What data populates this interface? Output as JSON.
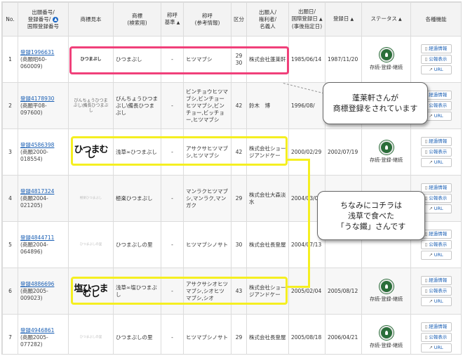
{
  "headers": {
    "no": "No.",
    "app_no": [
      "出願番号/",
      "登録番号/",
      "国際登録番号"
    ],
    "mark": "商標見本",
    "name": [
      "商標",
      "(検索用)"
    ],
    "pron_std": [
      "称呼",
      "基準"
    ],
    "pron_ref": [
      "称呼",
      "(参考情報)"
    ],
    "cls": "区分",
    "applicant": [
      "出願人/",
      "権利者/",
      "名義人"
    ],
    "filed": [
      "出願日/",
      "国際登録日",
      "(事後指定日)"
    ],
    "regdate": "登録日",
    "status": "ステータス",
    "funcs": "各種機能"
  },
  "rows": [
    {
      "no": "1",
      "reg": "登録1996631",
      "app": "(商願昭60-060009)",
      "mark": "ひつまぶし",
      "name": "ひつまぶし",
      "pron_std": "-",
      "pron_ref": "ヒツマブシ",
      "cls": "29\n30",
      "applicant": "株式会社蓬莱軒",
      "filed": "1985/06/14",
      "regdate": "1987/11/20",
      "status": "存続-登録-継続"
    },
    {
      "no": "2",
      "reg": "登録4178930",
      "app": "(商願平08-097600)",
      "mark": "びんちょうひつまぶし\\備長ひつまぶし",
      "name": "びんちょうひつまぶし\\備長ひつまぶし",
      "pron_std": "-",
      "pron_ref": "ビンチョウヒツマブシ,ビンチョーヒツマブシ,ビンチョー,ビッチョー,ヒツマブシ",
      "cls": "42",
      "applicant": "鈴木　博",
      "filed": "1996/08/",
      "regdate": "",
      "status": ""
    },
    {
      "no": "3",
      "reg": "登録4586398",
      "app": "(商願2000-018554)",
      "mark": "ひつまむし",
      "name": "浅草∞ひつまぶし",
      "pron_std": "-",
      "pron_ref": "アサクサヒツマブシ,ヒツマブシ",
      "cls": "42",
      "applicant": "株式会社ショージアンドケー",
      "filed": "2000/02/29",
      "regdate": "2002/07/19",
      "status": "存続-登録-継続"
    },
    {
      "no": "4",
      "reg": "登録4817324",
      "app": "(商願2004-021205)",
      "mark": "極楽ひつまぶし",
      "name": "極楽ひつまぶし",
      "pron_std": "-",
      "pron_ref": "マンラクヒツマブシ,マンラク,マンガク",
      "cls": "29",
      "applicant": "株式会社大森淡水",
      "filed": "2004/03/0",
      "regdate": "",
      "status": ""
    },
    {
      "no": "5",
      "reg": "登録4844711",
      "app": "(商願2004-064896)",
      "mark": "ひつまぶしの里",
      "name": "ひつまぶしの里",
      "pron_std": "-",
      "pron_ref": "ヒツマブシノサト",
      "cls": "30",
      "applicant": "株式会社長登屋",
      "filed": "2004/07/13",
      "regdate": "",
      "status": ""
    },
    {
      "no": "6",
      "reg": "登録4886696",
      "app": "(商願2005-009023)",
      "mark": "塩ひつまむし",
      "name": "浅草∞塩ひつまぶし",
      "pron_std": "-",
      "pron_ref": "アサクサシオヒツマブシ,シオヒツマブシ,シオ",
      "cls": "43",
      "applicant": "株式会社ショージアンドケー",
      "filed": "2005/02/04",
      "regdate": "2005/08/12",
      "status": "存続-登録-継続"
    },
    {
      "no": "7",
      "reg": "登録4946861",
      "app": "(商願2005-077282)",
      "mark": "ひつまぶしの里",
      "name": "ひつまぶしの里",
      "pron_std": "-",
      "pron_ref": "ヒツマブシノサト",
      "cls": "29",
      "applicant": "株式会社長登屋",
      "filed": "2005/08/18",
      "regdate": "2006/04/21",
      "status": "存続-登録-継続"
    }
  ],
  "buttons": {
    "progress": "経過情報",
    "gazette": "公報表示",
    "url": "URL"
  },
  "callouts": {
    "top": [
      "蓬莱軒さんが",
      "商標登録をされています"
    ],
    "mid": [
      "ちなみにコチラは",
      "浅草で食べた",
      "「うな鐵」さんです"
    ]
  },
  "colors": {
    "pink": "#f0407a",
    "yellow": "#f5ef21",
    "link": "#1a5fb4",
    "seal": "#2b6e3a"
  }
}
